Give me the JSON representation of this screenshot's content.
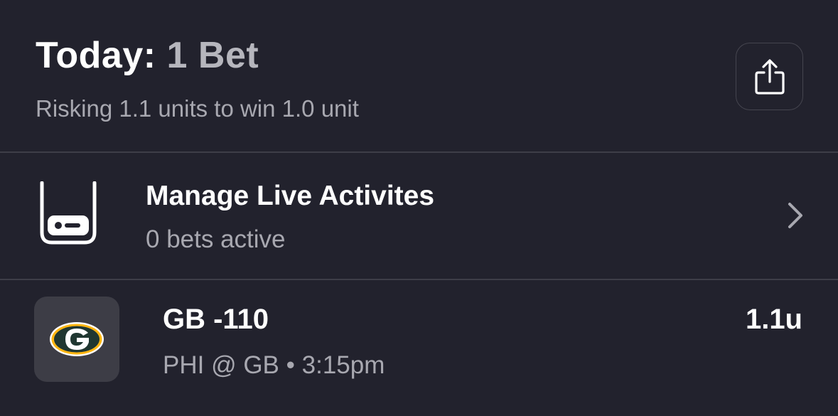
{
  "header": {
    "title_prefix": "Today:",
    "bet_count": "1 Bet",
    "summary": "Risking 1.1 units to win 1.0 unit",
    "share_icon": "share-icon"
  },
  "live_activities": {
    "title": "Manage Live Activites",
    "subtitle": "0 bets active",
    "icon": "live-activity-phone-icon",
    "chevron_icon": "chevron-right-icon"
  },
  "bets": [
    {
      "line": "GB -110",
      "game": "PHI @ GB",
      "separator": "•",
      "time": "3:15pm",
      "units": "1.1u",
      "team_logo": "green-bay-packers-logo",
      "team_logo_letter": "G"
    }
  ],
  "colors": {
    "background": "#22222d",
    "secondary_text": "#a8a8b0",
    "divider": "#3e3e48",
    "logo_tile": "#3d3d46",
    "packers_green": "#203731",
    "packers_gold": "#ffb612"
  }
}
